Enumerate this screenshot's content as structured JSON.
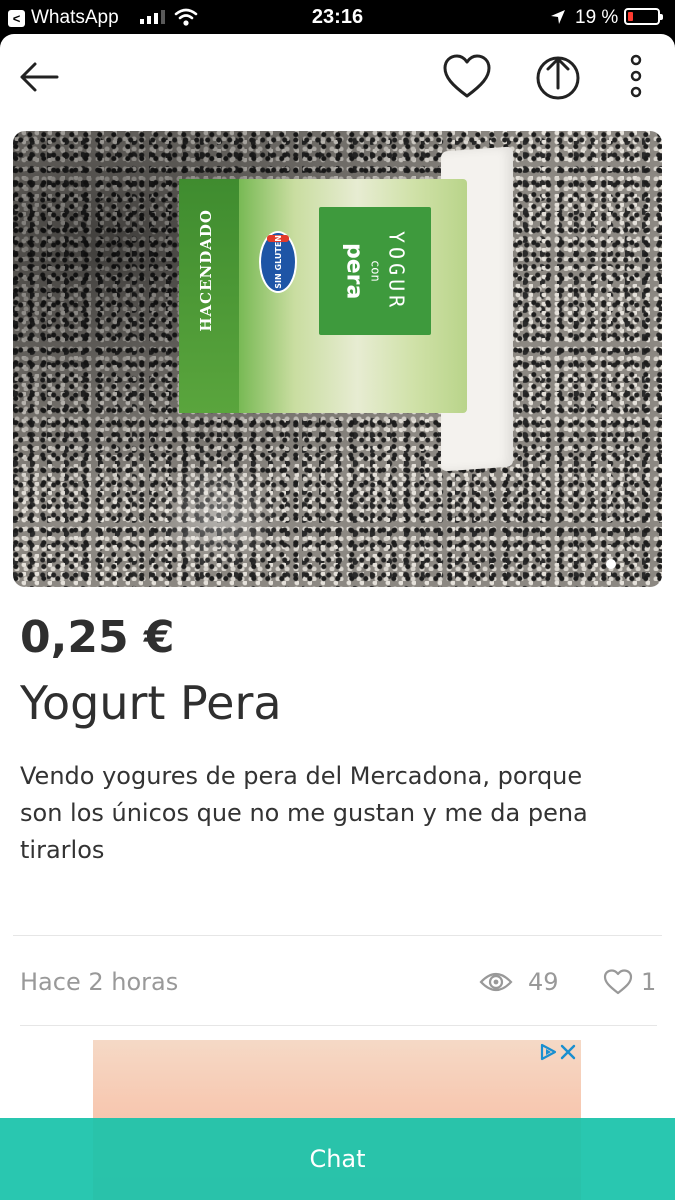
{
  "status_bar": {
    "back_app": "WhatsApp",
    "back_glyph": "<",
    "time": "23:16",
    "battery_percent": "19 %",
    "battery_level": 0.19,
    "battery_color": "#ff3b30"
  },
  "nav": {
    "icons": [
      "back-arrow-icon",
      "heart-icon",
      "share-icon",
      "more-vertical-icon"
    ]
  },
  "photo": {
    "brand": "HACENDADO",
    "badge_line1": "SIN",
    "badge_line2": "GLUTEN",
    "label_line1": "YOGUR",
    "label_line2": "con",
    "label_line3": "pera",
    "page_indicator_count": 1
  },
  "product": {
    "price": "0,25 €",
    "title": "Yogurt Pera",
    "description": "Vendo yogures de pera del Mercadona, porque son los únicos que no me gustan y me da pena tirarlos"
  },
  "meta": {
    "posted": "Hace 2 horas",
    "views": "49",
    "likes": "1"
  },
  "ad": {
    "icons": [
      "adchoices-icon",
      "close-icon"
    ]
  },
  "chat_button": {
    "label": "Chat",
    "color": "#19c3aa"
  }
}
